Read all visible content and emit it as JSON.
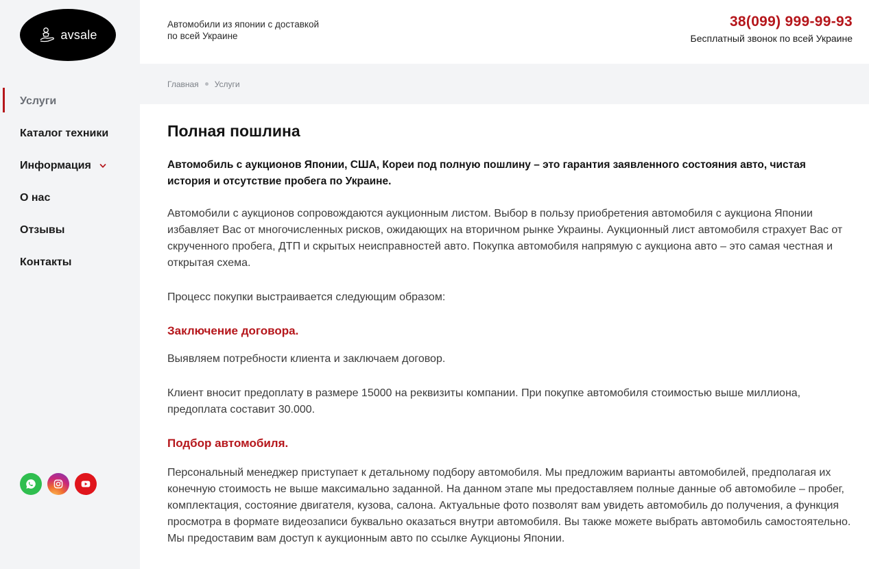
{
  "brand": {
    "logo_text": "avsale"
  },
  "header": {
    "tagline": "Автомобили из японии с доставкой по всей Украине",
    "phone": "38(099) 999-99-93",
    "phone_note": "Бесплатный звонок по всей Украине"
  },
  "sidebar": {
    "items": [
      {
        "label": "Услуги",
        "active": true
      },
      {
        "label": "Каталог техники"
      },
      {
        "label": "Информация",
        "has_dropdown": true
      },
      {
        "label": "О нас"
      },
      {
        "label": "Отзывы"
      },
      {
        "label": "Контакты"
      }
    ],
    "socials": [
      "whatsapp-icon",
      "instagram-icon",
      "youtube-icon"
    ]
  },
  "breadcrumb": {
    "home": "Главная",
    "current": "Услуги"
  },
  "content": {
    "title": "Полная пошлина",
    "lead": "Автомобиль с аукционов Японии, США, Кореи под полную пошлину – это гарантия заявленного состояния авто, чистая история и отсутствие пробега по Украине.",
    "p1": "Автомобили с аукционов сопровождаются аукционным листом. Выбор в пользу приобретения автомобиля с аукциона Японии избавляет Вас от многочисленных рисков, ожидающих на вторичном рынке Украины. Аукционный лист автомобиля страхует Вас от скрученного пробега, ДТП и скрытых неисправностей авто. Покупка автомобиля напрямую с аукциона авто – это самая честная и открытая схема.",
    "p2": "Процесс покупки выстраивается следующим образом:",
    "h1": "Заключение договора.",
    "p3": "Выявляем потребности клиента и заключаем договор.",
    "p4": "Клиент вносит предоплату в размере 15000 на реквизиты компании. При покупке автомобиля стоимостью выше миллиона, предоплата составит 30.000.",
    "h2": "Подбор автомобиля.",
    "p5": "Персональный менеджер приступает к детальному подбору автомобиля. Мы предложим варианты автомобилей, предполагая их конечную стоимость не выше максимально заданной. На данном этапе мы предоставляем полные данные об автомобиле – пробег, комплектация, состояние двигателя, кузова, салона. Актуальные фото позволят вам увидеть автомобиль до получения, а функция просмотра в формате видеозаписи буквально оказаться внутри автомобиля. Вы также можете выбрать автомобиль самостоятельно. Мы предоставим вам доступ к аукционным авто по ссылке Аукционы Японии."
  },
  "colors": {
    "accent": "#b5161b",
    "sidebar_bg": "#f3f4f6"
  }
}
